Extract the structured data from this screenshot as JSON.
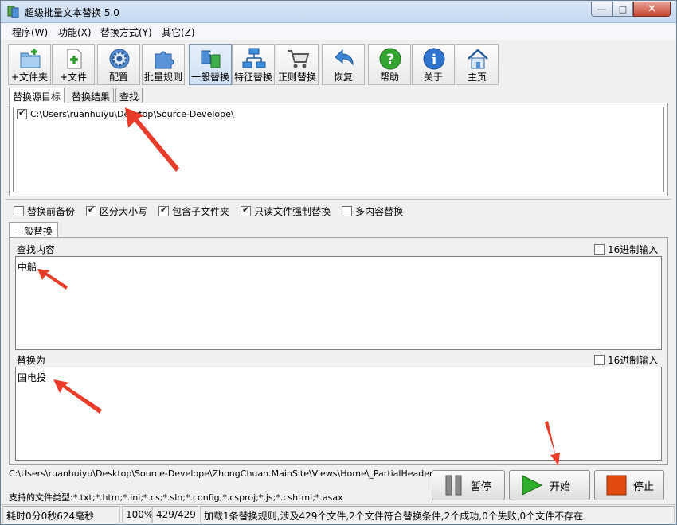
{
  "window": {
    "title": "超级批量文本替换 5.0",
    "controls": {
      "minimize": "—",
      "maximize": "□",
      "close": "✕"
    }
  },
  "menu": [
    {
      "label": "程序(W)"
    },
    {
      "label": "功能(X)"
    },
    {
      "label": "替换方式(Y)"
    },
    {
      "label": "其它(Z)"
    }
  ],
  "toolbar": [
    {
      "label": "+文件夹",
      "icon": "add-folder-icon"
    },
    {
      "label": "+文件",
      "icon": "add-file-icon"
    },
    {
      "label": "配置",
      "icon": "gear-icon"
    },
    {
      "label": "批量规则",
      "icon": "puzzle-icon"
    },
    {
      "label": "一般替换",
      "icon": "normal-replace-icon",
      "active": true
    },
    {
      "label": "特征替换",
      "icon": "network-icon"
    },
    {
      "label": "正则替换",
      "icon": "cart-icon"
    },
    {
      "label": "恢复",
      "icon": "undo-arrow-icon"
    },
    {
      "label": "帮助",
      "icon": "help-icon"
    },
    {
      "label": "关于",
      "icon": "info-icon"
    },
    {
      "label": "主页",
      "icon": "home-icon"
    }
  ],
  "source_tabs": [
    {
      "label": "替换源目标",
      "active": true
    },
    {
      "label": "替换结果"
    },
    {
      "label": "查找"
    }
  ],
  "source_list": [
    {
      "checked": true,
      "path": "C:\\Users\\ruanhuiyu\\Desktop\\Source-Develope\\"
    }
  ],
  "options": [
    {
      "label": "替换前备份",
      "checked": false
    },
    {
      "label": "区分大小写",
      "checked": true
    },
    {
      "label": "包含子文件夹",
      "checked": true
    },
    {
      "label": "只读文件强制替换",
      "checked": true
    },
    {
      "label": "多内容替换",
      "checked": false
    }
  ],
  "replace_tab": {
    "label": "一般替换"
  },
  "find": {
    "label": "查找内容",
    "hex_label": "16进制输入",
    "hex_checked": false,
    "value": "中船"
  },
  "replace": {
    "label": "替换为",
    "hex_label": "16进制输入",
    "hex_checked": false,
    "value": "国电投"
  },
  "status": {
    "current_file": "C:\\Users\\ruanhuiyu\\Desktop\\Source-Develope\\ZhongChuan.MainSite\\Views\\Home\\_PartialHeader.cshtml",
    "file_types": "支持的文件类型:*.txt;*.htm;*.ini;*.cs;*.sln;*.config;*.csproj;*.js;*.cshtml;*.asax",
    "elapsed": "耗时0分0秒624毫秒",
    "percent": "100%",
    "count": "429/429",
    "message": "加载1条替换规则,涉及429个文件,2个文件符合替换条件,2个成功,0个失败,0个文件不存在"
  },
  "actions": {
    "pause": "暂停",
    "start": "开始",
    "stop": "停止"
  },
  "colors": {
    "start_green": "#2fae2b",
    "stop_red": "#e24a10",
    "annotation_red": "#e83b2a"
  }
}
